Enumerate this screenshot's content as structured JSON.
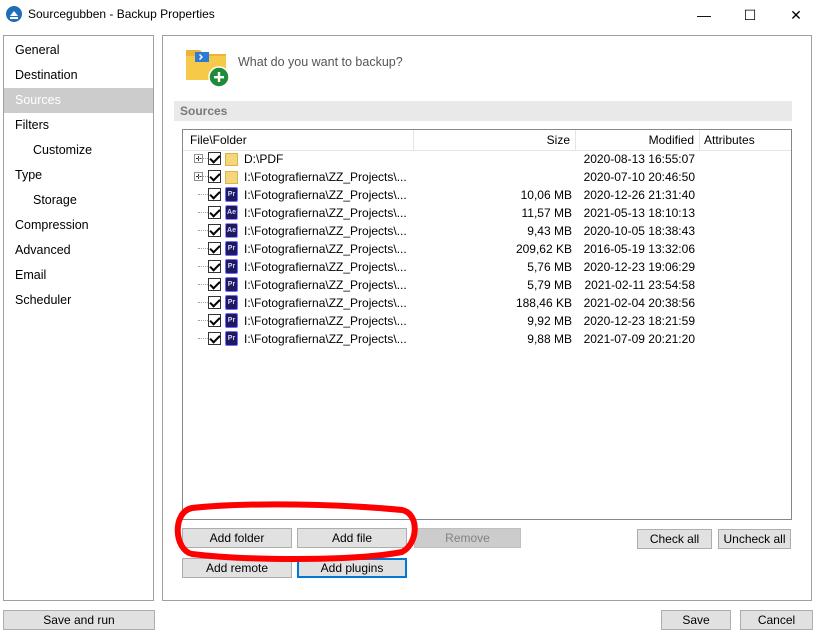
{
  "window": {
    "title": "Sourcegubben - Backup Properties",
    "minimize_glyph": "—",
    "maximize_glyph": "☐",
    "close_glyph": "✕"
  },
  "nav": {
    "items": [
      {
        "label": "General",
        "selected": false
      },
      {
        "label": "Destination",
        "selected": false
      },
      {
        "label": "Sources",
        "selected": true
      },
      {
        "label": "Filters",
        "selected": false
      },
      {
        "label": "Customize",
        "selected": false,
        "sub": true
      },
      {
        "label": "Type",
        "selected": false
      },
      {
        "label": "Storage",
        "selected": false,
        "sub": true
      },
      {
        "label": "Compression",
        "selected": false
      },
      {
        "label": "Advanced",
        "selected": false
      },
      {
        "label": "Email",
        "selected": false
      },
      {
        "label": "Scheduler",
        "selected": false
      }
    ]
  },
  "sources": {
    "prompt": "What do you want to backup?",
    "section_header": "Sources",
    "columns": {
      "file": "File\\Folder",
      "size": "Size",
      "modified": "Modified",
      "attributes": "Attributes"
    },
    "rows": [
      {
        "icon": "folder",
        "name": "D:\\PDF",
        "size": "",
        "modified": "2020-08-13 16:55:07",
        "expandable": true
      },
      {
        "icon": "folder",
        "name": "I:\\Fotografierna\\ZZ_Projects\\...",
        "size": "",
        "modified": "2020-07-10 20:46:50",
        "expandable": true
      },
      {
        "icon": "pr",
        "name": "I:\\Fotografierna\\ZZ_Projects\\...",
        "size": "10,06 MB",
        "modified": "2020-12-26 21:31:40"
      },
      {
        "icon": "ae",
        "name": "I:\\Fotografierna\\ZZ_Projects\\...",
        "size": "11,57 MB",
        "modified": "2021-05-13 18:10:13"
      },
      {
        "icon": "ae",
        "name": "I:\\Fotografierna\\ZZ_Projects\\...",
        "size": "9,43 MB",
        "modified": "2020-10-05 18:38:43"
      },
      {
        "icon": "pr",
        "name": "I:\\Fotografierna\\ZZ_Projects\\...",
        "size": "209,62 KB",
        "modified": "2016-05-19 13:32:06"
      },
      {
        "icon": "pr",
        "name": "I:\\Fotografierna\\ZZ_Projects\\...",
        "size": "5,76 MB",
        "modified": "2020-12-23 19:06:29"
      },
      {
        "icon": "pr",
        "name": "I:\\Fotografierna\\ZZ_Projects\\...",
        "size": "5,79 MB",
        "modified": "2021-02-11 23:54:58"
      },
      {
        "icon": "pr",
        "name": "I:\\Fotografierna\\ZZ_Projects\\...",
        "size": "188,46 KB",
        "modified": "2021-02-04 20:38:56"
      },
      {
        "icon": "pr",
        "name": "I:\\Fotografierna\\ZZ_Projects\\...",
        "size": "9,92 MB",
        "modified": "2020-12-23 18:21:59"
      },
      {
        "icon": "pr",
        "name": "I:\\Fotografierna\\ZZ_Projects\\...",
        "size": "9,88 MB",
        "modified": "2021-07-09 20:21:20"
      }
    ],
    "icon_text": {
      "pr": "Pr",
      "ae": "Ae"
    }
  },
  "buttons": {
    "add_folder": "Add folder",
    "add_file": "Add file",
    "remove": "Remove",
    "check_all": "Check all",
    "uncheck_all": "Uncheck all",
    "add_remote": "Add remote",
    "add_plugins": "Add plugins",
    "save_and_run": "Save and run",
    "save": "Save",
    "cancel": "Cancel"
  },
  "colors": {
    "annotation": "#ff0000",
    "selected_nav_bg": "#cccccc",
    "accent": "#0078d7"
  }
}
